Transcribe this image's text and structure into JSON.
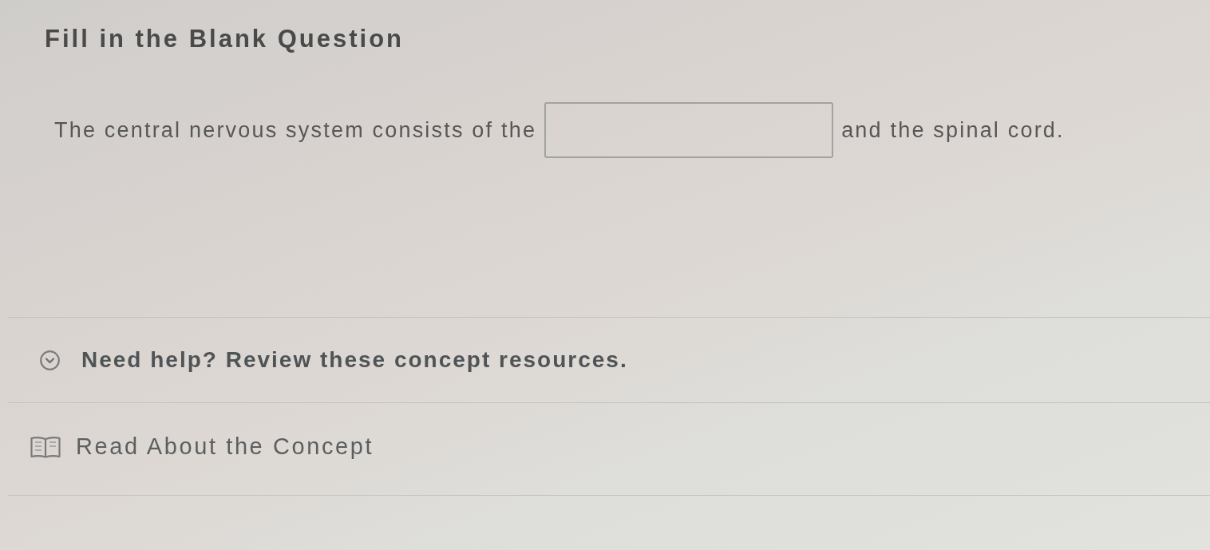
{
  "title": "Fill in the Blank Question",
  "question": {
    "parts": [
      {
        "kind": "text",
        "text": "The central nervous system consists of the"
      },
      {
        "kind": "blank"
      },
      {
        "kind": "text",
        "text": "and the spinal cord."
      }
    ]
  },
  "help": {
    "label": "Need help? Review these concept resources."
  },
  "resources": [
    {
      "label": "Read About the Concept"
    }
  ]
}
